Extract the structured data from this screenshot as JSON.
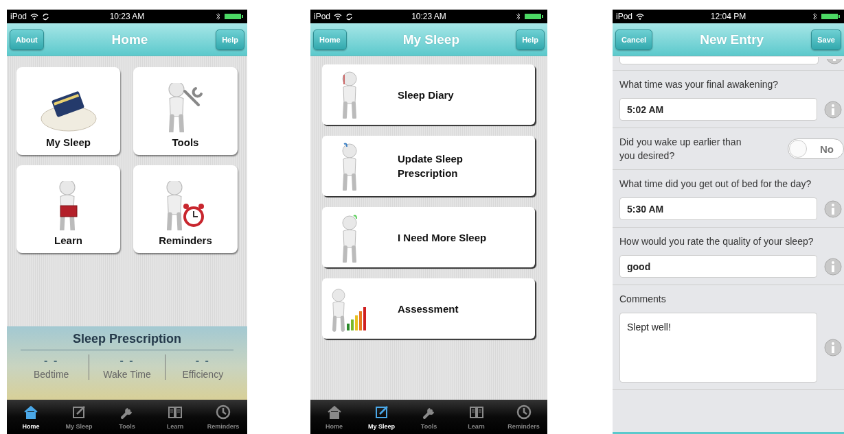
{
  "screens": [
    {
      "kind": "home",
      "status": {
        "carrier": "iPod",
        "syncing": true,
        "time": "10:23 AM"
      },
      "nav": {
        "left_button": "About",
        "title": "Home",
        "right_button": "Help"
      },
      "tiles": [
        {
          "label": "My Sleep"
        },
        {
          "label": "Tools"
        },
        {
          "label": "Learn"
        },
        {
          "label": "Reminders"
        }
      ],
      "prescription": {
        "title": "Sleep Prescription",
        "stats": [
          {
            "value": "- -",
            "label": "Bedtime"
          },
          {
            "value": "- -",
            "label": "Wake Time"
          },
          {
            "value": "- -",
            "label": "Efficiency"
          }
        ]
      },
      "tabs": [
        {
          "label": "Home",
          "selected": true
        },
        {
          "label": "My Sleep",
          "selected": false
        },
        {
          "label": "Tools",
          "selected": false
        },
        {
          "label": "Learn",
          "selected": false
        },
        {
          "label": "Reminders",
          "selected": false
        }
      ]
    },
    {
      "kind": "menu",
      "status": {
        "carrier": "iPod",
        "syncing": true,
        "time": "10:23 AM"
      },
      "nav": {
        "left_button": "Home",
        "title": "My Sleep",
        "right_button": "Help"
      },
      "items": [
        {
          "label": "Sleep Diary"
        },
        {
          "label": "Update Sleep Prescription"
        },
        {
          "label": "I Need More Sleep"
        },
        {
          "label": "Assessment"
        }
      ],
      "tabs": [
        {
          "label": "Home",
          "selected": false
        },
        {
          "label": "My Sleep",
          "selected": true
        },
        {
          "label": "Tools",
          "selected": false
        },
        {
          "label": "Learn",
          "selected": false
        },
        {
          "label": "Reminders",
          "selected": false
        }
      ]
    },
    {
      "kind": "form",
      "status": {
        "carrier": "iPod",
        "syncing": false,
        "time": "12:04 PM"
      },
      "nav": {
        "left_button": "Cancel",
        "title": "New Entry",
        "right_button": "Save"
      },
      "rows": [
        {
          "kind": "field",
          "label": "What time was your final awakening?",
          "value": "5:02 AM"
        },
        {
          "kind": "toggle",
          "label": "Did you wake up earlier than you desired?",
          "on": false,
          "state_text": "No"
        },
        {
          "kind": "field",
          "label": "What time did you get out of bed for the day?",
          "value": "5:30 AM"
        },
        {
          "kind": "field",
          "label": "How would you rate the quality of your sleep?",
          "value": "good"
        },
        {
          "kind": "textarea",
          "label": "Comments",
          "value": "Slept well!"
        }
      ]
    }
  ]
}
